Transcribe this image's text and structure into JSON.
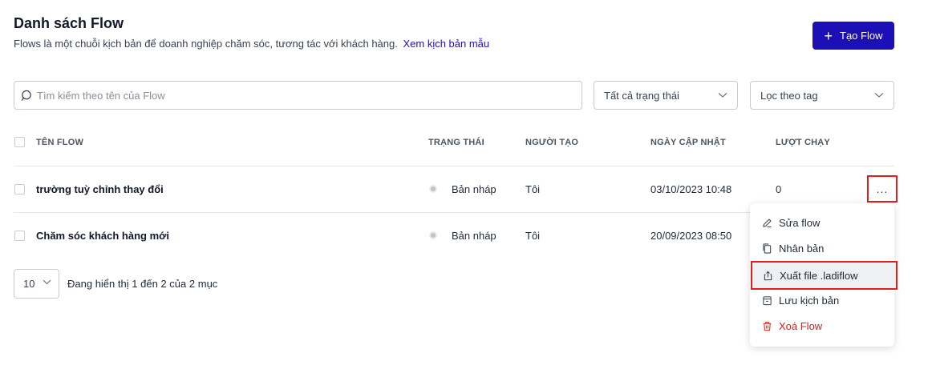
{
  "header": {
    "title": "Danh sách Flow",
    "subtitle": "Flows là một chuỗi kịch bản để doanh nghiệp chăm sóc, tương tác với khách hàng.",
    "sample_link": "Xem kịch bản mẫu",
    "create_button": "Tạo Flow"
  },
  "filters": {
    "search_placeholder": "Tìm kiếm theo tên của Flow",
    "status_select": "Tất cả trạng thái",
    "tag_select": "Lọc theo tag"
  },
  "table": {
    "columns": [
      "TÊN FLOW",
      "TRẠNG THÁI",
      "NGƯỜI TẠO",
      "NGÀY CẬP NHẬT",
      "LƯỢT CHẠY"
    ],
    "rows": [
      {
        "name": "trường tuỳ chỉnh thay đổi",
        "status": "Bản nháp",
        "creator": "Tôi",
        "updated": "03/10/2023 10:48",
        "runs": "0"
      },
      {
        "name": "Chăm sóc khách hàng mới",
        "status": "Bản nháp",
        "creator": "Tôi",
        "updated": "20/09/2023 08:50",
        "runs": ""
      }
    ],
    "more_label": "..."
  },
  "pagination": {
    "page_size": "10",
    "info_prefix": "Đang hiển thị",
    "from": "1",
    "to_word": "đến",
    "to": "2",
    "of_word": "của",
    "total": "2",
    "unit": "mục"
  },
  "context_menu": {
    "items": [
      {
        "label": "Sửa flow",
        "icon": "edit-icon"
      },
      {
        "label": "Nhân bản",
        "icon": "copy-icon"
      },
      {
        "label": "Xuất file .ladiflow",
        "icon": "export-icon"
      },
      {
        "label": "Lưu kịch bản",
        "icon": "save-template-icon"
      },
      {
        "label": "Xoá Flow",
        "icon": "trash-icon"
      }
    ]
  },
  "colors": {
    "primary": "#1b0fb5",
    "link": "#1d10b8",
    "danger": "#d51f1f",
    "highlight_border": "#e01e1e",
    "status_dot": "#bfc2c7"
  }
}
